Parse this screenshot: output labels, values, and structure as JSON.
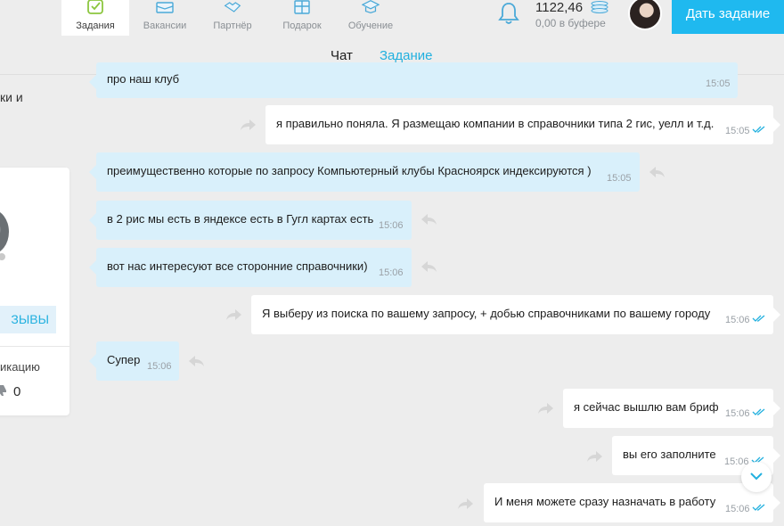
{
  "nav": {
    "items": [
      {
        "label": "Задания",
        "icon": "tasks-icon",
        "active": true
      },
      {
        "label": "Вакансии",
        "icon": "briefcase-icon"
      },
      {
        "label": "Партнёр",
        "icon": "handshake-icon"
      },
      {
        "label": "Подарок",
        "icon": "gift-icon"
      },
      {
        "label": "Обучение",
        "icon": "graduation-cap-icon"
      }
    ],
    "balance": "1122,46",
    "buffer": "0,00 в буфере",
    "give_task": "Дать задание"
  },
  "tabs": {
    "chat": "Чат",
    "task": "Задание"
  },
  "left_panel": {
    "text_top": "ки и",
    "reviews": "ЗЫВЫ",
    "text_bottom": "икацию",
    "dislike_count": "0"
  },
  "messages": [
    {
      "text": "про наш клуб",
      "time": "15:05",
      "direction": "in"
    },
    {
      "text": "я правильно поняла. Я размещаю компании в справочники типа 2 гис, уелл и т.д.",
      "time": "15:05",
      "direction": "out",
      "read": true
    },
    {
      "text": "преимущественно которые по запросу Компьютерный клубы Красноярск индексируются )",
      "time": "15:05",
      "direction": "in"
    },
    {
      "text": "в 2 рис мы есть в яндексе есть в Гугл картах есть",
      "time": "15:06",
      "direction": "in"
    },
    {
      "text": "вот нас интересуют все сторонние справочники)",
      "time": "15:06",
      "direction": "in"
    },
    {
      "text": "Я выберу из поиска по вашему запросу, + добью справочниками по вашему городу",
      "time": "15:06",
      "direction": "out",
      "read": true
    },
    {
      "text": "Супер",
      "time": "15:06",
      "direction": "in"
    },
    {
      "text": "я сейчас вышлю вам бриф",
      "time": "15:06",
      "direction": "out",
      "read": true
    },
    {
      "text": "вы его заполните",
      "time": "15:06",
      "direction": "out",
      "read": true
    },
    {
      "text": "И меня можете сразу назначать в работу",
      "time": "15:06",
      "direction": "out",
      "read": true
    }
  ],
  "colors": {
    "accent": "#1fb9ef",
    "incoming_bubble": "#d9f0fb",
    "outgoing_bubble": "#ffffff",
    "tab_underline": "#9ed37a"
  }
}
